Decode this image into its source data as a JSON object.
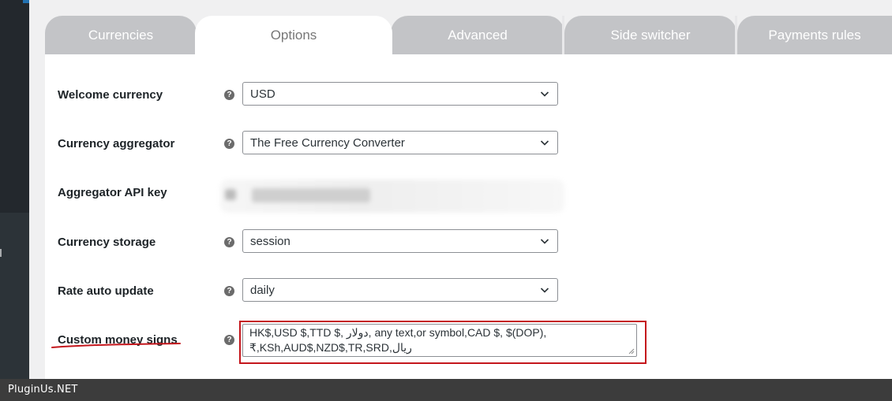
{
  "tabs": [
    {
      "label": "Currencies",
      "active": false
    },
    {
      "label": "Options",
      "active": true
    },
    {
      "label": "Advanced",
      "active": false
    },
    {
      "label": "Side switcher",
      "active": false
    },
    {
      "label": "Payments rules",
      "active": false
    }
  ],
  "options": {
    "welcome_currency": {
      "label": "Welcome currency",
      "value": "USD",
      "help_icon": "question-circle-icon"
    },
    "currency_aggregator": {
      "label": "Currency aggregator",
      "value": "The Free Currency Converter",
      "help_icon": "question-circle-icon"
    },
    "aggregator_api_key": {
      "label": "Aggregator API key",
      "value_obscured": true
    },
    "currency_storage": {
      "label": "Currency storage",
      "value": "session",
      "help_icon": "question-circle-icon"
    },
    "rate_auto_update": {
      "label": "Rate auto update",
      "value": "daily",
      "help_icon": "question-circle-icon"
    },
    "custom_money_signs": {
      "label": "Custom money signs",
      "value": "HK$,USD $,TTD $, دولار, any text,or symbol,CAD $, $(DOP), ₹,KSh,AUD$,NZD$,TR,SRD,ریال",
      "help_icon": "question-circle-icon"
    }
  },
  "help_glyph": "?",
  "colors": {
    "tab_inactive_bg": "#c3c4c7",
    "tab_active_bg": "#ffffff",
    "highlight": "#c4161c",
    "sidebar": "#2c3338",
    "footer": "#3c3c3c"
  },
  "footer": {
    "text": "PluginUs.NET"
  }
}
